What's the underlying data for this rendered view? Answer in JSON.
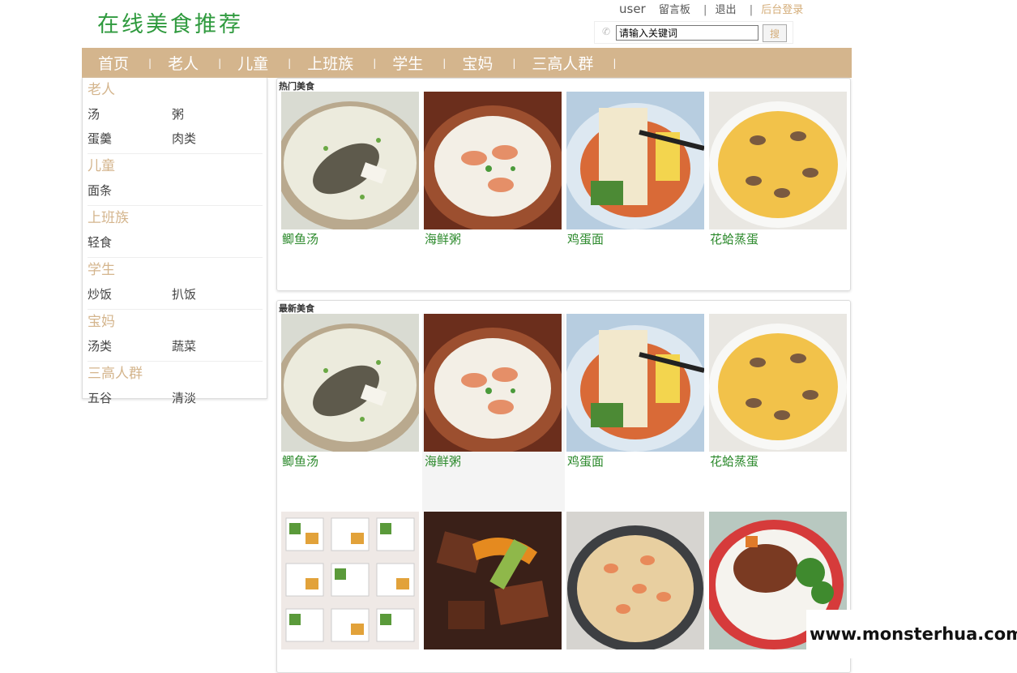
{
  "site": {
    "title": "在线美食推荐"
  },
  "header": {
    "user": "user",
    "guestbook": "留言板",
    "logout": "退出",
    "admin": "后台登录",
    "separator": "|"
  },
  "search": {
    "value": "请输入关键词",
    "button": "搜"
  },
  "nav": {
    "items": [
      "首页",
      "老人",
      "儿童",
      "上班族",
      "学生",
      "宝妈",
      "三高人群"
    ],
    "separator": "|"
  },
  "sidebar": {
    "categories": [
      {
        "name": "老人",
        "items": [
          "汤",
          "粥",
          "蛋羹",
          "肉类"
        ]
      },
      {
        "name": "儿童",
        "items": [
          "面条"
        ]
      },
      {
        "name": "上班族",
        "items": [
          "轻食"
        ]
      },
      {
        "name": "学生",
        "items": [
          "炒饭",
          "扒饭"
        ]
      },
      {
        "name": "宝妈",
        "items": [
          "汤类",
          "蔬菜"
        ]
      },
      {
        "name": "三高人群",
        "items": [
          "五谷",
          "清淡"
        ]
      }
    ]
  },
  "hot": {
    "title": "热门美食",
    "items": [
      "鲫鱼汤",
      "海鲜粥",
      "鸡蛋面",
      "花蛤蒸蛋"
    ]
  },
  "latest": {
    "title": "最新美食",
    "items": [
      "鲫鱼汤",
      "海鲜粥",
      "鸡蛋面",
      "花蛤蒸蛋"
    ]
  },
  "watermark": "www.monsterhua.com",
  "colors": {
    "brand_green": "#2f9a3e",
    "nav_tan": "#d4b58d",
    "food_link": "#2d8a2d"
  }
}
